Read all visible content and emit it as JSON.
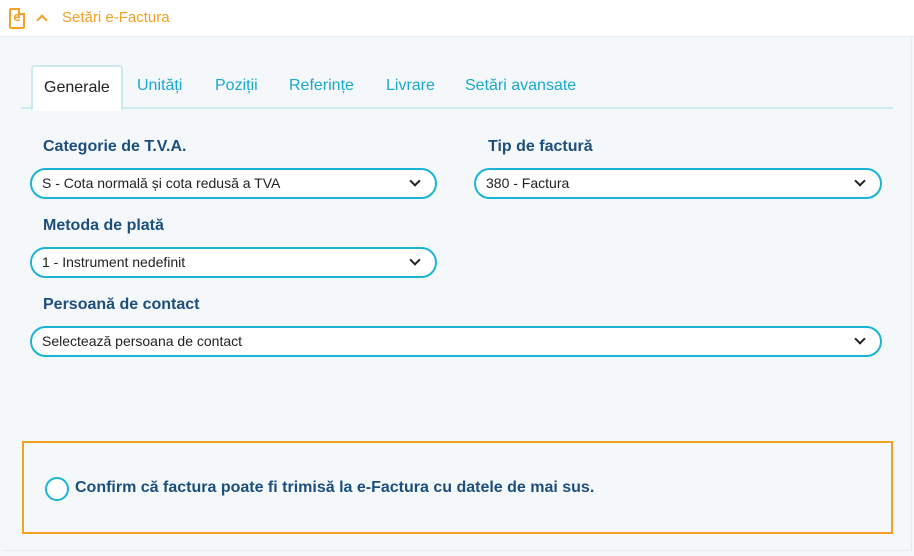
{
  "header": {
    "icon_letter": "e",
    "title": "Setări e-Factura"
  },
  "tabs": [
    {
      "label": "Generale",
      "active": true
    },
    {
      "label": "Unități",
      "active": false
    },
    {
      "label": "Poziții",
      "active": false
    },
    {
      "label": "Referințe",
      "active": false
    },
    {
      "label": "Livrare",
      "active": false
    },
    {
      "label": "Setări avansate",
      "active": false
    }
  ],
  "fields": {
    "vat_category": {
      "label": "Categorie de T.V.A.",
      "value": "S - Cota normală și cota redusă a TVA"
    },
    "invoice_type": {
      "label": "Tip de factură",
      "value": "380 - Factura"
    },
    "payment_method": {
      "label": "Metoda de plată",
      "value": "1 - Instrument nedefinit"
    },
    "contact_person": {
      "label": "Persoană de contact",
      "value": "Selectează persoana de contact"
    }
  },
  "confirm": {
    "text": "Confirm că factura poate fi trimisă la e-Factura cu datele de mai sus.",
    "checked": false
  },
  "colors": {
    "accent_orange": "#f2a125",
    "accent_cyan": "#19b4d8",
    "label_blue": "#1d4f7c"
  },
  "icons": [
    "e-factura-icon",
    "chevron-up-icon",
    "chevron-down-icon",
    "radio-icon"
  ]
}
